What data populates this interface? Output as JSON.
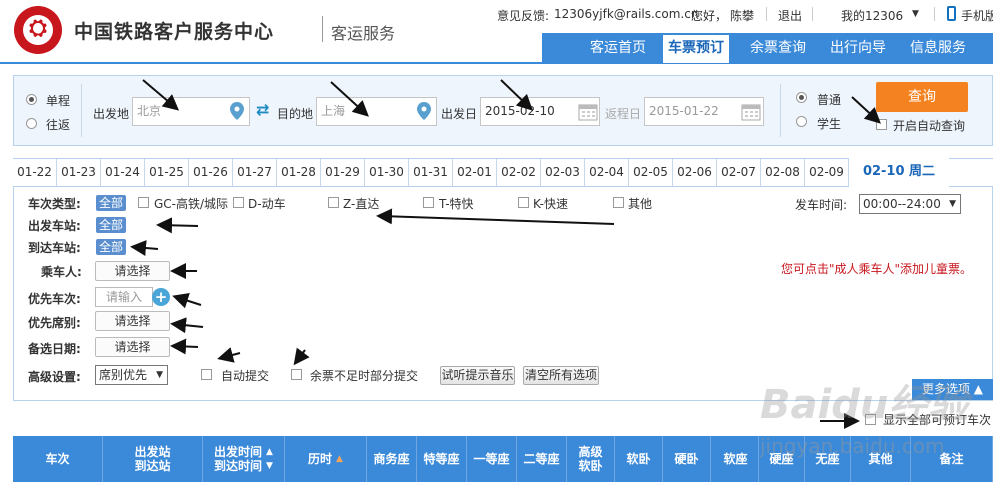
{
  "header": {
    "site_title": "中国铁路客户服务中心",
    "subtitle": "客运服务",
    "feedback_label": "意见反馈:",
    "feedback_email": "12306yjfk@rails.com.cn",
    "greeting": "您好，",
    "user_name": "陈攀",
    "logout": "退出",
    "my_account": "我的12306",
    "mobile": "手机版"
  },
  "nav": {
    "items": [
      {
        "label": "客运首页"
      },
      {
        "label": "车票预订"
      },
      {
        "label": "余票查询"
      },
      {
        "label": "出行向导"
      },
      {
        "label": "信息服务"
      }
    ]
  },
  "search": {
    "trip_single": "单程",
    "trip_return": "往返",
    "from_label": "出发地",
    "from_value": "北京",
    "to_label": "目的地",
    "to_value": "上海",
    "depart_label": "出发日",
    "depart_value": "2015-02-10",
    "return_label": "返程日",
    "return_value": "2015-01-22",
    "ticket_normal": "普通",
    "ticket_student": "学生",
    "query_button": "查询",
    "auto_query": "开启自动查询"
  },
  "dates": {
    "tabs": [
      "01-22",
      "01-23",
      "01-24",
      "01-25",
      "01-26",
      "01-27",
      "01-28",
      "01-29",
      "01-30",
      "01-31",
      "02-01",
      "02-02",
      "02-03",
      "02-04",
      "02-05",
      "02-06",
      "02-07",
      "02-08",
      "02-09"
    ],
    "active": "02-10 周二"
  },
  "filters": {
    "train_type_label": "车次类型:",
    "all": "全部",
    "train_types": [
      "GC-高铁/城际",
      "D-动车",
      "Z-直达",
      "T-特快",
      "K-快速",
      "其他"
    ],
    "depart_time_label": "发车时间:",
    "depart_time_value": "00:00--24:00",
    "from_station_label": "出发车站:",
    "to_station_label": "到达车站:",
    "passenger_label": "乘车人:",
    "priority_train_label": "优先车次:",
    "priority_seat_label": "优先席别:",
    "backup_date_label": "备选日期:",
    "advanced_label": "高级设置:",
    "choose": "请选择",
    "input_placeholder": "请输入",
    "seat_priority": "席别优先",
    "auto_submit": "自动提交",
    "partial_submit": "余票不足时部分提交",
    "test_music": "试听提示音乐",
    "clear_all": "清空所有选项",
    "child_hint": "您可点击\"成人乘车人\"添加儿童票。",
    "more_options": "更多选项",
    "show_all": "显示全部可预订车次"
  },
  "table": {
    "headers": [
      {
        "label": "车次"
      },
      {
        "label": "出发站\n到达站"
      },
      {
        "label": "出发时间\n到达时间"
      },
      {
        "label": "历时"
      },
      {
        "label": "商务座"
      },
      {
        "label": "特等座"
      },
      {
        "label": "一等座"
      },
      {
        "label": "二等座"
      },
      {
        "label": "高级\n软卧"
      },
      {
        "label": "软卧"
      },
      {
        "label": "硬卧"
      },
      {
        "label": "软座"
      },
      {
        "label": "硬座"
      },
      {
        "label": "无座"
      },
      {
        "label": "其他"
      },
      {
        "label": "备注"
      }
    ]
  },
  "watermark": {
    "main": "Baidu经验",
    "sub": "jingyan.baidu.com"
  }
}
